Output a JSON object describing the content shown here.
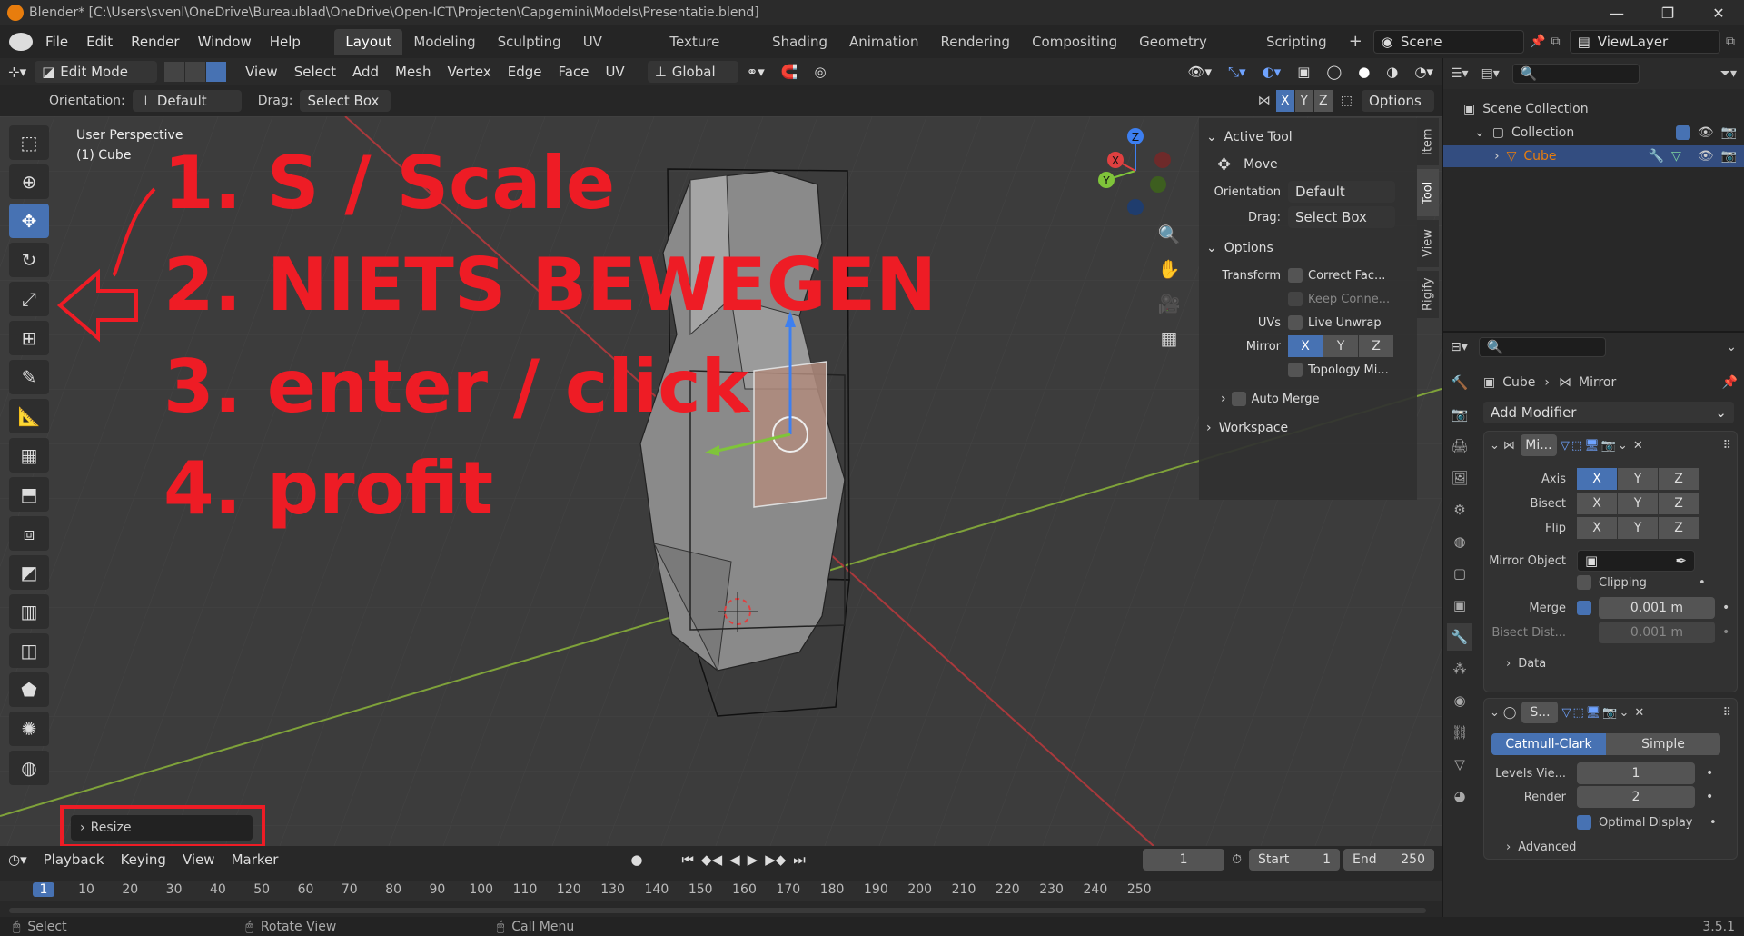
{
  "window": {
    "title": "Blender* [C:\\Users\\svenl\\OneDrive\\Bureaublad\\OneDrive\\Open-ICT\\Projecten\\Capgemini\\Models\\Presentatie.blend]",
    "version": "3.5.1"
  },
  "menu": [
    "File",
    "Edit",
    "Render",
    "Window",
    "Help"
  ],
  "workspaces": [
    "Layout",
    "Modeling",
    "Sculpting",
    "UV Editing",
    "Texture Paint",
    "Shading",
    "Animation",
    "Rendering",
    "Compositing",
    "Geometry Nodes",
    "Scripting"
  ],
  "active_workspace": "Layout",
  "scene": "Scene",
  "view_layer": "ViewLayer",
  "viewport_header": {
    "mode": "Edit Mode",
    "menus": [
      "View",
      "Select",
      "Add",
      "Mesh",
      "Vertex",
      "Edge",
      "Face",
      "UV"
    ],
    "transform_orientation": "Global"
  },
  "tool_header": {
    "orientation_label": "Orientation:",
    "orientation_value": "Default",
    "drag_label": "Drag:",
    "drag_value": "Select Box",
    "mirror_axes": [
      "X",
      "Y",
      "Z"
    ],
    "options_label": "Options"
  },
  "viewport": {
    "perspective": "User Perspective",
    "object": "(1) Cube",
    "operator_panel": "Resize"
  },
  "annotations": [
    "1. S / Scale",
    "2. NIETS BEWEGEN",
    "3. enter / click",
    "4. profit"
  ],
  "n_panel": {
    "tabs": [
      "Item",
      "Tool",
      "View",
      "Rigify"
    ],
    "active_tab": "Tool",
    "active_tool_header": "Active Tool",
    "tool_name": "Move",
    "orientation_label": "Orientation",
    "orientation_value": "Default",
    "drag_label": "Drag:",
    "drag_value": "Select Box",
    "options_header": "Options",
    "transform_label": "Transform",
    "correct_face": "Correct Fac...",
    "keep_connected": "Keep Conne...",
    "uvs_label": "UVs",
    "live_unwrap": "Live Unwrap",
    "mirror_label": "Mirror",
    "topology_mirror": "Topology Mi...",
    "auto_merge": "Auto Merge",
    "workspace_header": "Workspace"
  },
  "outliner": {
    "items": [
      {
        "label": "Scene Collection"
      },
      {
        "label": "Collection"
      },
      {
        "label": "Cube"
      }
    ]
  },
  "properties": {
    "breadcrumb_object": "Cube",
    "breadcrumb_modifier": "Mirror",
    "add_modifier": "Add Modifier",
    "mirror": {
      "name": "Mi...",
      "axis_label": "Axis",
      "bisect_label": "Bisect",
      "flip_label": "Flip",
      "mirror_object_label": "Mirror Object",
      "clipping_label": "Clipping",
      "merge_label": "Merge",
      "merge_value": "0.001 m",
      "bisect_distance_label": "Bisect Dist...",
      "bisect_distance_value": "0.001 m",
      "data_label": "Data"
    },
    "subsurf": {
      "name": "S...",
      "catmull": "Catmull-Clark",
      "simple": "Simple",
      "levels_label": "Levels Vie...",
      "levels_value": "1",
      "render_label": "Render",
      "render_value": "2",
      "optimal_display": "Optimal Display",
      "advanced": "Advanced"
    }
  },
  "timeline": {
    "menus": [
      "Playback",
      "Keying",
      "View",
      "Marker"
    ],
    "current_frame": "1",
    "start_label": "Start",
    "start_value": "1",
    "end_label": "End",
    "end_value": "250",
    "ruler": [
      "1",
      "10",
      "20",
      "30",
      "40",
      "50",
      "60",
      "70",
      "80",
      "90",
      "100",
      "110",
      "120",
      "130",
      "140",
      "150",
      "160",
      "170",
      "180",
      "190",
      "200",
      "210",
      "220",
      "230",
      "240",
      "250"
    ]
  },
  "status_bar": {
    "select": "Select",
    "rotate_view": "Rotate View",
    "call_menu": "Call Menu"
  },
  "colors": {
    "accent": "#4772b3",
    "annotation": "#ee1c25",
    "selection_orange": "#e87d0d"
  }
}
